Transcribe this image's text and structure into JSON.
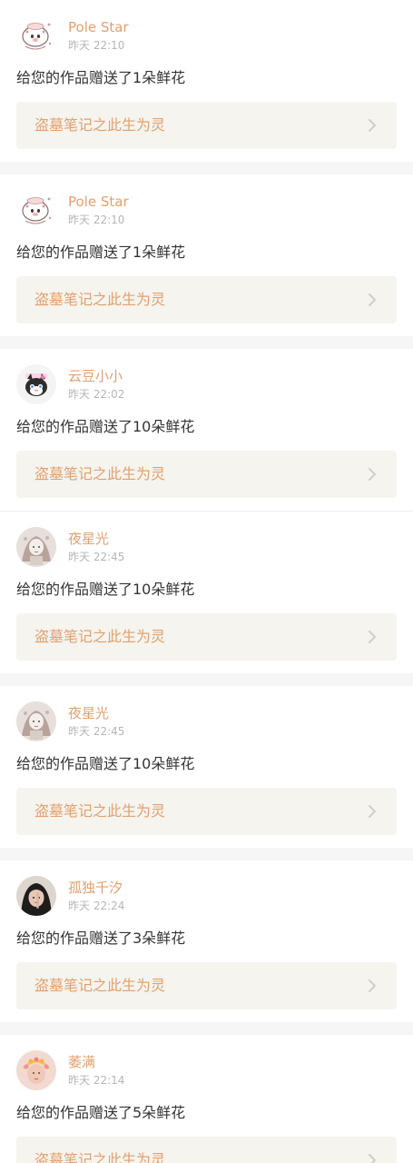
{
  "notifications": [
    {
      "user": "Pole Star",
      "time": "昨天 22:10",
      "message": "给您的作品赠送了1朵鲜花",
      "work_title": "盗墓笔记之此生为灵",
      "avatar_icon": "cartoon-pig-icon"
    },
    {
      "user": "Pole Star",
      "time": "昨天 22:10",
      "message": "给您的作品赠送了1朵鲜花",
      "work_title": "盗墓笔记之此生为灵",
      "avatar_icon": "cartoon-pig-icon"
    },
    {
      "user": "云豆小小",
      "time": "昨天 22:02",
      "message": "给您的作品赠送了10朵鲜花",
      "work_title": "盗墓笔记之此生为灵",
      "avatar_icon": "cat-face-icon"
    },
    {
      "user": "夜星光",
      "time": "昨天 22:45",
      "message": "给您的作品赠送了10朵鲜花",
      "work_title": "盗墓笔记之此生为灵",
      "avatar_icon": "sketch-portrait-icon"
    },
    {
      "user": "夜星光",
      "time": "昨天 22:45",
      "message": "给您的作品赠送了10朵鲜花",
      "work_title": "盗墓笔记之此生为灵",
      "avatar_icon": "sketch-portrait-icon"
    },
    {
      "user": "孤独千汐",
      "time": "昨天 22:24",
      "message": "给您的作品赠送了3朵鲜花",
      "work_title": "盗墓笔记之此生为灵",
      "avatar_icon": "girl-photo-icon"
    },
    {
      "user": "萎满",
      "time": "昨天 22:14",
      "message": "给您的作品赠送了5朵鲜花",
      "work_title": "盗墓笔记之此生为灵",
      "avatar_icon": "flower-crown-photo-icon"
    }
  ],
  "colors": {
    "accent": "#e3a06f",
    "link_bg": "#f5f4ee",
    "time": "#b6b6b6",
    "text": "#333333",
    "page_bg": "#f7f6f6"
  }
}
